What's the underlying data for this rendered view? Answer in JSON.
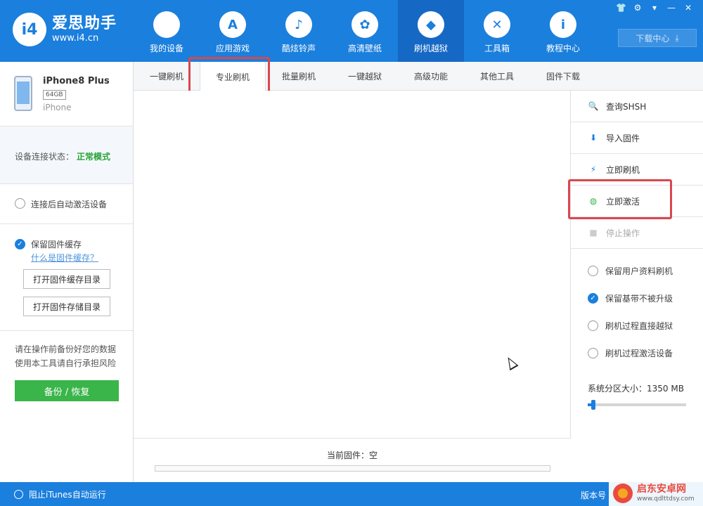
{
  "app": {
    "logo_mark": "i4",
    "name": "爱思助手",
    "url": "www.i4.cn",
    "accent_color": "#1b7fdd"
  },
  "nav": [
    {
      "label": "我的设备",
      "icon": "apple-icon",
      "glyph": "",
      "active": false
    },
    {
      "label": "应用游戏",
      "icon": "app-store-icon",
      "glyph": "A",
      "active": false
    },
    {
      "label": "酷炫铃声",
      "icon": "bell-icon",
      "glyph": "♪",
      "active": false
    },
    {
      "label": "高清壁纸",
      "icon": "flower-icon",
      "glyph": "✿",
      "active": false
    },
    {
      "label": "刷机越狱",
      "icon": "dropbox-icon",
      "glyph": "◆",
      "active": true
    },
    {
      "label": "工具箱",
      "icon": "tools-icon",
      "glyph": "✕",
      "active": false
    },
    {
      "label": "教程中心",
      "icon": "info-icon",
      "glyph": "i",
      "active": false
    }
  ],
  "window_controls": [
    "shirt-icon",
    "gear-icon",
    "menu-icon",
    "minimize-icon",
    "close-icon"
  ],
  "download_center": {
    "label": "下载中心",
    "icon": "download-icon"
  },
  "device": {
    "name": "iPhone8 Plus",
    "capacity": "64GB",
    "model": "iPhone"
  },
  "connection": {
    "label": "设备连接状态：",
    "value": "正常模式",
    "value_color": "#2aa33a"
  },
  "left_options": {
    "auto_activate": {
      "label": "连接后自动激活设备",
      "checked": false
    },
    "keep_cache": {
      "label": "保留固件缓存",
      "checked": true,
      "link": "什么是固件缓存？"
    },
    "open_cache_dir": "打开固件缓存目录",
    "open_store_dir": "打开固件存储目录"
  },
  "warning": {
    "line1": "请在操作前备份好您的数据",
    "line2": "使用本工具请自行承担风险"
  },
  "backup_button": "备份 / 恢复",
  "tabs": [
    {
      "label": "一键刷机",
      "active": false
    },
    {
      "label": "专业刷机",
      "active": true
    },
    {
      "label": "批量刷机",
      "active": false
    },
    {
      "label": "一键越狱",
      "active": false
    },
    {
      "label": "高级功能",
      "active": false
    },
    {
      "label": "其他工具",
      "active": false
    },
    {
      "label": "固件下载",
      "active": false
    }
  ],
  "firmware": {
    "label": "当前固件：空",
    "progress": 0
  },
  "actions": [
    {
      "label": "查询SHSH",
      "icon": "search-shsh-icon",
      "glyph": "🔍",
      "disabled": false
    },
    {
      "label": "导入固件",
      "icon": "import-icon",
      "glyph": "⬇",
      "disabled": false
    },
    {
      "label": "立即刷机",
      "icon": "flash-icon",
      "glyph": "⚡",
      "disabled": false
    },
    {
      "label": "立即激活",
      "icon": "globe-icon",
      "glyph": "◍",
      "disabled": false
    },
    {
      "label": "停止操作",
      "icon": "stop-icon",
      "glyph": "■",
      "disabled": true
    }
  ],
  "right_options": [
    {
      "label": "保留用户资料刷机",
      "checked": false
    },
    {
      "label": "保留基带不被升级",
      "checked": true
    },
    {
      "label": "刷机过程直接越狱",
      "checked": false
    },
    {
      "label": "刷机过程激活设备",
      "checked": false
    }
  ],
  "partition": {
    "label": "系统分区大小：1350 MB",
    "level": 0.06
  },
  "footer": {
    "itunes": "阻止iTunes自动运行",
    "version": "版本号"
  },
  "watermark": {
    "name": "启东安卓网",
    "url": "www.qdlttdsy.com"
  }
}
